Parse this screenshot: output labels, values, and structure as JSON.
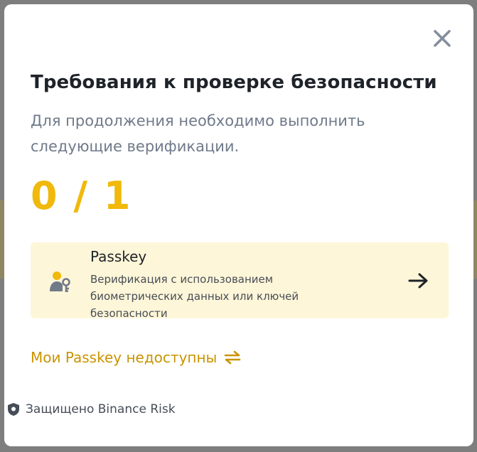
{
  "modal": {
    "title": "Требования к проверке безопасности",
    "subtitle": "Для продолжения необходимо выполнить следующие верификации.",
    "progress": "0 / 1",
    "close_icon": "close-icon"
  },
  "passkey_card": {
    "title": "Passkey",
    "description": "Верификация с использованием биометрических данных или ключей безопасности",
    "icon": "user-key-icon",
    "arrow_icon": "arrow-right-icon"
  },
  "alt_link": {
    "label": "Мои Passkey недоступны",
    "icon": "swap-arrows-icon"
  },
  "footer": {
    "label": "Защищено Binance Risk",
    "icon": "shield-icon"
  },
  "colors": {
    "accent": "#f0b90b",
    "link": "#c99400",
    "card_bg": "#fef6d8",
    "title": "#1e2329",
    "muted": "#707a8a"
  }
}
